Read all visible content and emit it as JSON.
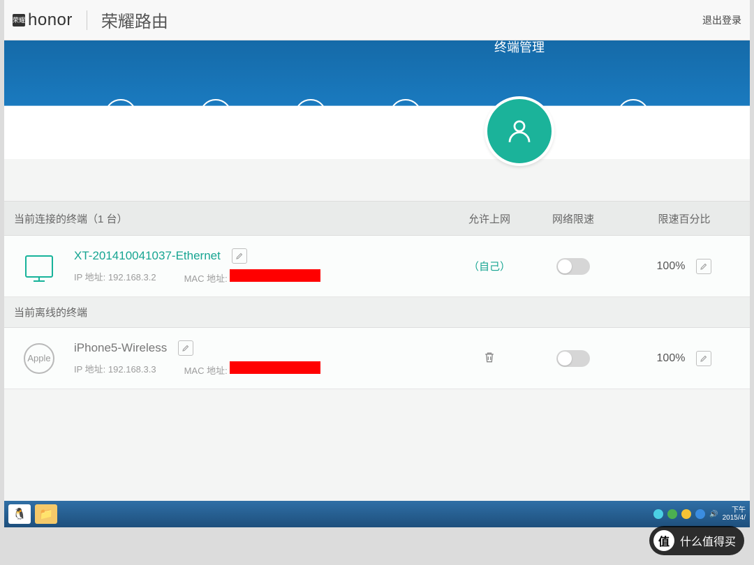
{
  "header": {
    "brand_badge": "荣耀",
    "brand_text": "honor",
    "page_title": "荣耀路由",
    "logout": "退出登录"
  },
  "nav": {
    "active_label": "终端管理",
    "icons": [
      "home-icon",
      "globe-icon",
      "wifi-icon",
      "apn-icon",
      "user-icon",
      "menu-icon"
    ]
  },
  "columns": {
    "connected_header": "当前连接的终端（1 台）",
    "allow": "允许上网",
    "limit": "网络限速",
    "percent": "限速百分比",
    "offline_header": "当前离线的终端"
  },
  "devices": {
    "online": {
      "name": "XT-201410041037-Ethernet",
      "ip_label": "IP 地址:",
      "ip": "192.168.3.2",
      "mac_label": "MAC 地址:",
      "allow_text": "（自己）",
      "percent": "100%"
    },
    "offline": {
      "name": "iPhone5-Wireless",
      "ip_label": "IP 地址:",
      "ip": "192.168.3.3",
      "mac_label": "MAC 地址:",
      "brand": "Apple",
      "percent": "100%"
    }
  },
  "taskbar": {
    "time": "下午",
    "date": "2015/4/"
  },
  "watermark": {
    "symbol": "值",
    "text": "什么值得买"
  }
}
